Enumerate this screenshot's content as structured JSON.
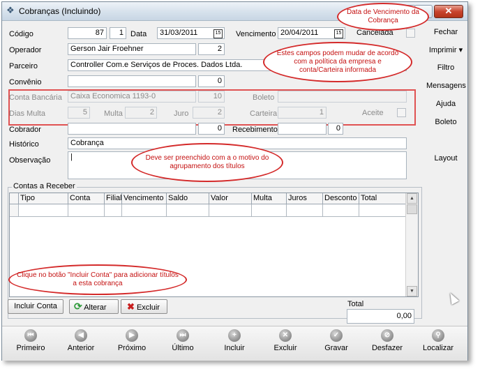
{
  "window": {
    "title": "Cobranças (Incluindo)",
    "close_glyph": "✕"
  },
  "form": {
    "codigo_label": "Código",
    "codigo_value": "87",
    "codigo_seq": "1",
    "data_label": "Data",
    "data_value": "31/03/2011",
    "vencimento_label": "Vencimento",
    "vencimento_value": "20/04/2011",
    "cancelada_label": "Cancelada",
    "operador_label": "Operador",
    "operador_value": "Gerson Jair Froehner",
    "operador_code": "2",
    "parceiro_label": "Parceiro",
    "parceiro_value": "Controller Com.e Serviços de Proces. Dados Ltda.",
    "convenio_label": "Convênio",
    "convenio_code": "0",
    "conta_bancaria_label": "Conta Bancária",
    "conta_bancaria_value": "Caixa Economica 1193-0",
    "conta_bancaria_code": "10",
    "boleto_label": "Boleto",
    "dias_multa_label": "Dias Multa",
    "dias_multa_value": "5",
    "multa_label": "Multa",
    "multa_value": "2",
    "juro_label": "Juro",
    "juro_value": "2",
    "carteira_label": "Carteira",
    "carteira_value": "1",
    "aceite_label": "Aceite",
    "cobrador_label": "Cobrador",
    "cobrador_code": "0",
    "recebimento_label": "Recebimento",
    "recebimento_code": "0",
    "historico_label": "Histórico",
    "historico_value": "Cobrança",
    "observacao_label": "Observação"
  },
  "calendar_glyph": "15",
  "side_menu": [
    "Fechar",
    "Imprimir ▾",
    "Filtro",
    "Mensagens",
    "Ajuda",
    "Boleto",
    "Layout"
  ],
  "contas": {
    "group_title": "Contas a Receber",
    "columns": [
      "Tipo",
      "Conta",
      "Filial",
      "Vencimento",
      "Saldo",
      "Valor",
      "Multa",
      "Juros",
      "Desconto",
      "Total"
    ],
    "total_label": "Total",
    "total_value": "0,00"
  },
  "buttons": {
    "incluir_conta": "Incluir Conta",
    "alterar": "Alterar",
    "excluir": "Excluir"
  },
  "navbar": [
    {
      "label": "Primeiro",
      "glyph": "⏮"
    },
    {
      "label": "Anterior",
      "glyph": "◀"
    },
    {
      "label": "Próximo",
      "glyph": "▶"
    },
    {
      "label": "Último",
      "glyph": "⏭"
    },
    {
      "label": "Incluir",
      "glyph": "+"
    },
    {
      "label": "Excluir",
      "glyph": "✕"
    },
    {
      "label": "Gravar",
      "glyph": "✓"
    },
    {
      "label": "Desfazer",
      "glyph": "⊘"
    },
    {
      "label": "Localizar",
      "glyph": "⚲"
    }
  ],
  "callouts": {
    "vencimento": "Data de Vencimento da Cobrança",
    "campos": "Estes campos podem mudar de acordo com a política da empresa e conta/Carteira informada",
    "observacao": "Deve ser preenchido com a o motivo do agrupamento dos títulos",
    "incluir": "Clique no botão \"Incluir Conta\" para adicionar títulos a esta cobrança"
  },
  "colors": {
    "callout_border": "#d42a2a",
    "callout_text": "#c41010",
    "highlight_box": "#e05252",
    "alterar_icon": "#2e9a3a",
    "excluir_icon": "#c81e1e"
  }
}
